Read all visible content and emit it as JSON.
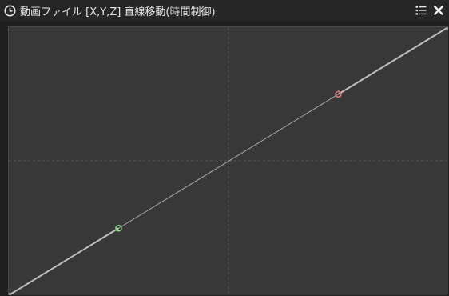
{
  "window": {
    "title": "動画ファイル [X,Y,Z] 直線移動(時間制御)",
    "title_icon": "clock-icon",
    "menu_icon": "list-menu-icon",
    "close_icon": "close-icon"
  },
  "curve": {
    "start_point": {
      "x": 0,
      "y": 0
    },
    "end_point": {
      "x": 1,
      "y": 1
    },
    "control_point_1": {
      "x": 0.25,
      "y": 0.25,
      "color": "#7ddc7d"
    },
    "control_point_2": {
      "x": 0.75,
      "y": 0.75,
      "color": "#e07a7a"
    },
    "grid_midlines": true
  },
  "colors": {
    "background": "#383838",
    "titlebar": "#262626",
    "curve_line": "#c8c8c8",
    "handle_line": "#a8a8a8",
    "grid": "#5a5a5a"
  }
}
